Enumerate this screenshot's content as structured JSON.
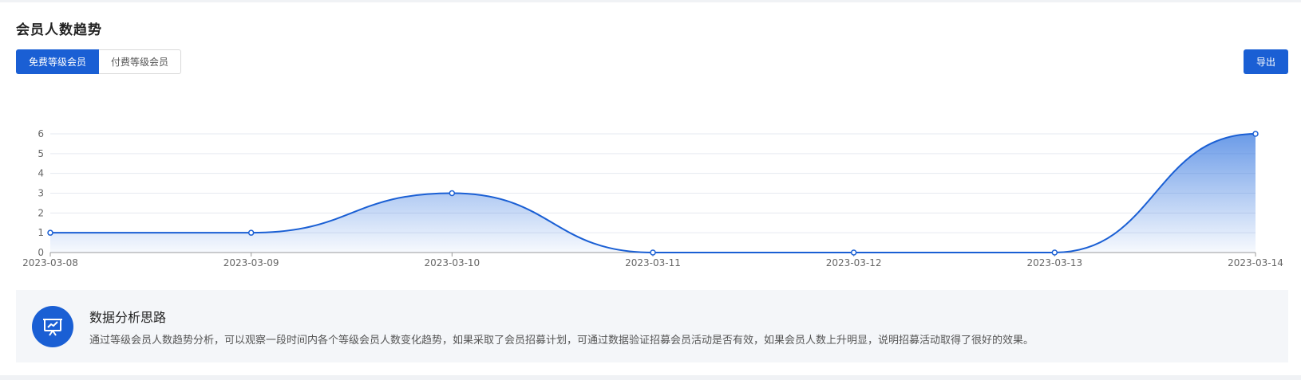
{
  "header": {
    "title": "会员人数趋势"
  },
  "tabs": [
    {
      "label": "免费等级会员",
      "active": true
    },
    {
      "label": "付费等级会员",
      "active": false
    }
  ],
  "export_label": "导出",
  "analysis": {
    "title": "数据分析思路",
    "description": "通过等级会员人数趋势分析，可以观察一段时间内各个等级会员人数变化趋势，如果采取了会员招募计划，可通过数据验证招募会员活动是否有效，如果会员人数上升明显，说明招募活动取得了很好的效果。",
    "icon": "presentation-chart-icon"
  },
  "colors": {
    "accent": "#1a5fd4",
    "line": "#1a5fd4",
    "area_top": "#3a7ae0",
    "grid": "#e6e9f0"
  },
  "chart_data": {
    "type": "area",
    "title": "",
    "xlabel": "",
    "ylabel": "",
    "x": [
      "2023-03-08",
      "2023-03-09",
      "2023-03-10",
      "2023-03-11",
      "2023-03-12",
      "2023-03-13",
      "2023-03-14"
    ],
    "series": [
      {
        "values": [
          1,
          1,
          3,
          0,
          0,
          0,
          6
        ]
      }
    ],
    "ylim": [
      0,
      6
    ],
    "yticks": [
      0,
      1,
      2,
      3,
      4,
      5,
      6
    ],
    "grid": true,
    "smooth": true,
    "legend": "none"
  }
}
